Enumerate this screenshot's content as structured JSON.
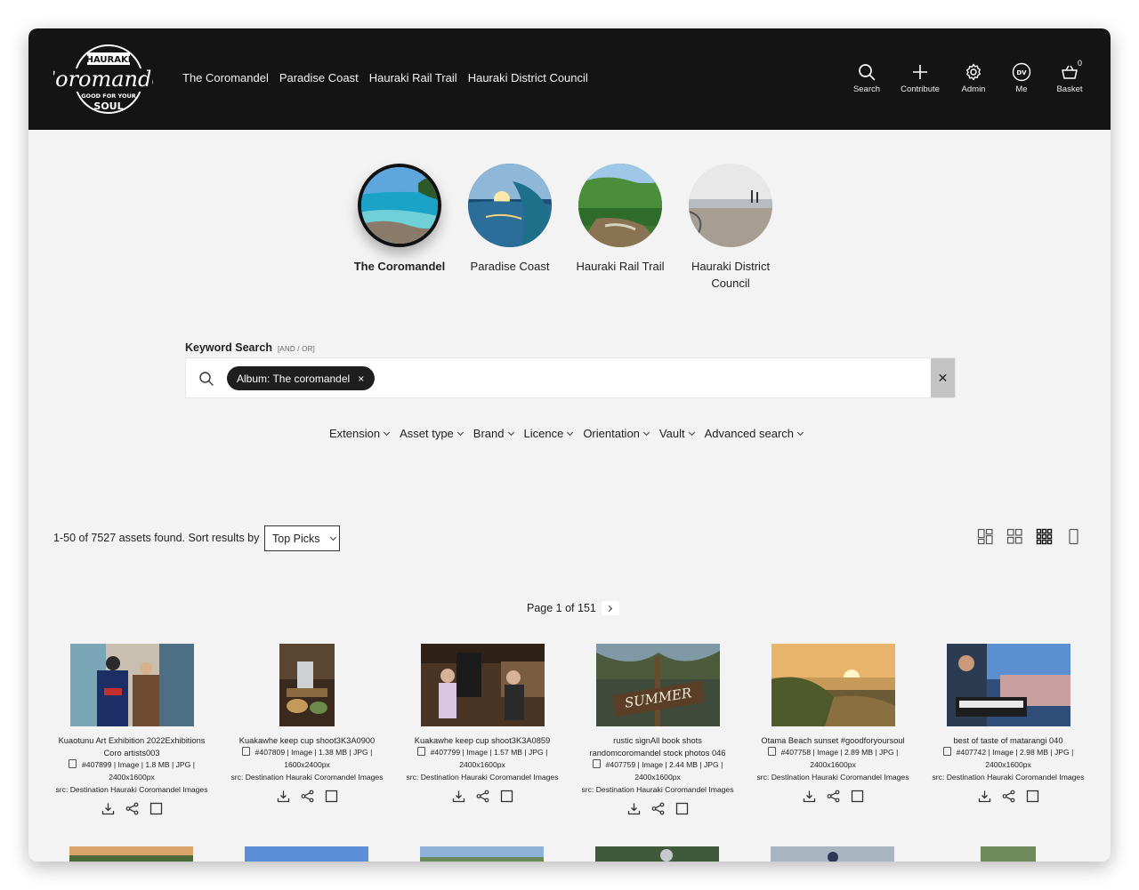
{
  "logo": {
    "top_text": "HAURAKI",
    "script_text": "Coromandel",
    "tag1": "GOOD FOR YOUR",
    "tag2": "SOUL"
  },
  "nav": [
    "The Coromandel",
    "Paradise Coast",
    "Hauraki Rail Trail",
    "Hauraki District Council"
  ],
  "toolbar": {
    "search_label": "Search",
    "contribute_label": "Contribute",
    "admin_label": "Admin",
    "me_label": "Me",
    "me_initials": "DV",
    "basket_label": "Basket",
    "basket_count": "0"
  },
  "albums": [
    {
      "label": "The Coromandel",
      "active": true
    },
    {
      "label": "Paradise Coast",
      "active": false
    },
    {
      "label": "Hauraki Rail Trail",
      "active": false
    },
    {
      "label": "Hauraki District Council",
      "active": false
    }
  ],
  "keyword_search": {
    "title": "Keyword Search",
    "hint": "[AND / OR]",
    "chip": "Album: The coromandel",
    "chip_remove": "×",
    "clear": "✕"
  },
  "filters": [
    "Extension",
    "Asset type",
    "Brand",
    "Licence",
    "Orientation",
    "Vault",
    "Advanced search"
  ],
  "results": {
    "count_text": "1-50 of 7527 assets found. Sort results by",
    "sort_value": "Top Picks",
    "page_text": "Page 1 of 151"
  },
  "assets": [
    {
      "title": "Kuaotunu Art Exhibition 2022Exhibitions Coro artists003",
      "meta": "#407899 | Image | 1.8 MB | JPG |",
      "dims": "2400x1600px",
      "src": "src: Destination Hauraki Coromandel Images"
    },
    {
      "title": "Kuakawhe keep cup shoot3K3A0900",
      "meta": "#407809 | Image | 1.38 MB | JPG |",
      "dims": "1600x2400px",
      "src": "src: Destination Hauraki Coromandel Images"
    },
    {
      "title": "Kuakawhe keep cup shoot3K3A0859",
      "meta": "#407799 | Image | 1.57 MB | JPG |",
      "dims": "2400x1600px",
      "src": "src: Destination Hauraki Coromandel Images"
    },
    {
      "title": "rustic signAll book shots randomcoromandel stock photos 046",
      "meta": "#407759 | Image | 2.44 MB | JPG |",
      "dims": "2400x1600px",
      "src": "src: Destination Hauraki Coromandel Images"
    },
    {
      "title": "Otama Beach sunset #goodforyoursoul",
      "meta": "#407758 | Image | 2.89 MB | JPG |",
      "dims": "2400x1600px",
      "src": "src: Destination Hauraki Coromandel Images"
    },
    {
      "title": "best of taste of matarangi 040",
      "meta": "#407742 | Image | 2.98 MB | JPG |",
      "dims": "2400x1600px",
      "src": "src: Destination Hauraki Coromandel Images"
    }
  ],
  "asset_image_text": "SUMMER"
}
